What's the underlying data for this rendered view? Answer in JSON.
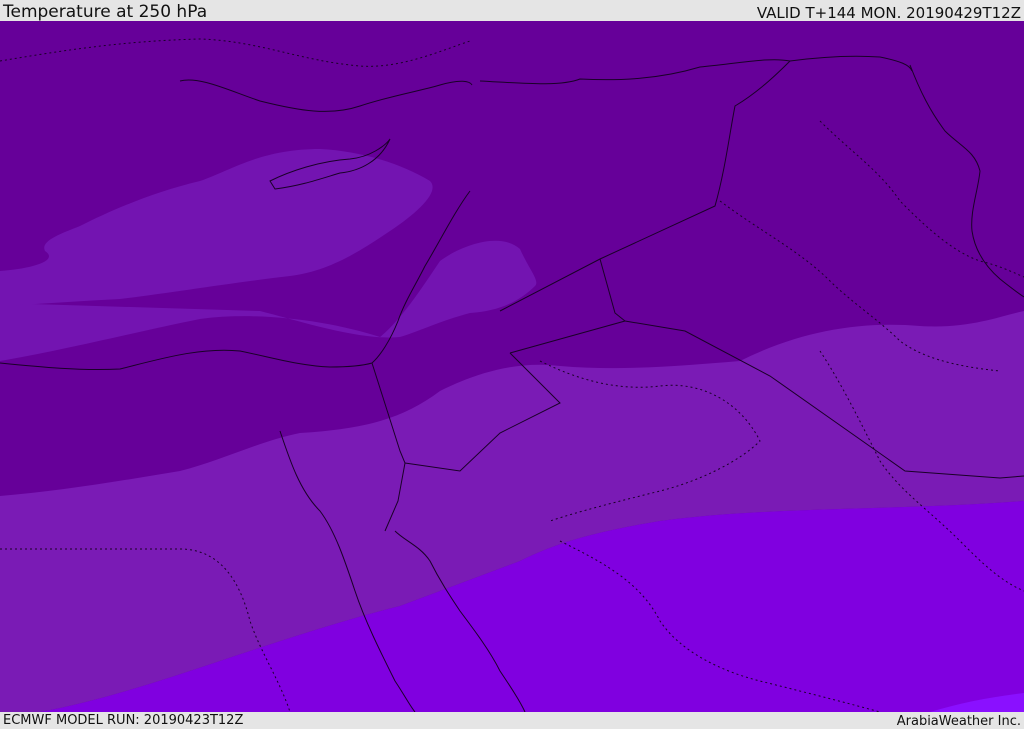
{
  "header": {
    "title": "Temperature at 250 hPa",
    "valid": "VALID T+144 MON. 20190429T12Z"
  },
  "map": {
    "colors": {
      "coldest": "#660099",
      "cold": "#7314b1",
      "mid": "#7a1bb5",
      "warm": "#8000e0",
      "warmest": "#8a10ff",
      "lines": "#1a0028"
    }
  },
  "footer": {
    "model_run": "ECMWF MODEL RUN: 20190423T12Z",
    "brand": "ArabiaWeather Inc."
  }
}
